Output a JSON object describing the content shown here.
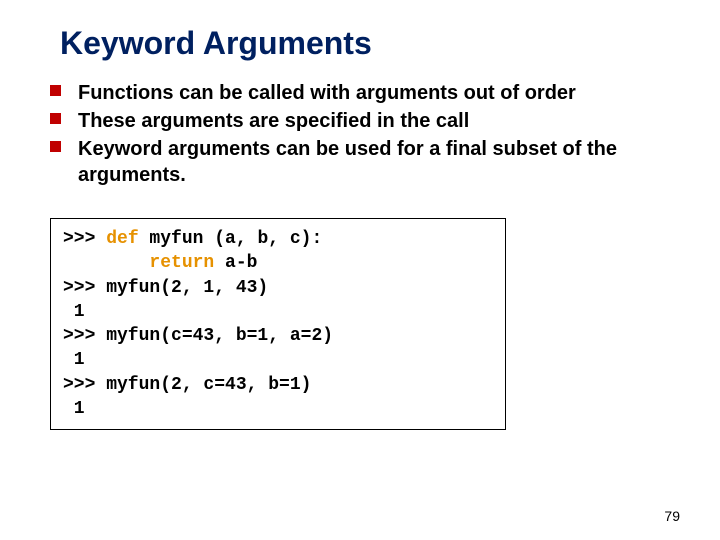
{
  "title": "Keyword Arguments",
  "bullets": [
    "Functions can be called with arguments out of order",
    "These arguments are specified in the call",
    "Keyword arguments can be used for a final subset of the arguments."
  ],
  "code": {
    "p1": ">>> ",
    "kw_def": "def",
    "p1b": " myfun (a, b, c):",
    "p2a": "        ",
    "kw_ret": "return",
    "p2b": " a-b",
    "l3": ">>> myfun(2, 1, 43)",
    "l4": " 1",
    "l5": ">>> myfun(c=43, b=1, a=2)",
    "l6": " 1",
    "l7": ">>> myfun(2, c=43, b=1)",
    "l8": " 1"
  },
  "page": "79"
}
